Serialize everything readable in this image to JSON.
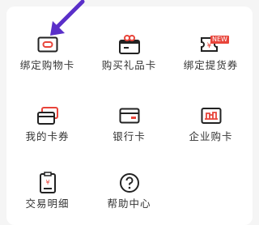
{
  "items": [
    {
      "label": "绑定购物卡",
      "icon": "bind-card-icon"
    },
    {
      "label": "购买礼品卡",
      "icon": "gift-card-icon"
    },
    {
      "label": "绑定提货券",
      "icon": "pickup-voucher-icon",
      "badge": "NEW"
    },
    {
      "label": "我的卡券",
      "icon": "my-cards-icon"
    },
    {
      "label": "银行卡",
      "icon": "bank-card-icon"
    },
    {
      "label": "企业购卡",
      "icon": "enterprise-card-icon"
    },
    {
      "label": "交易明细",
      "icon": "transaction-detail-icon"
    },
    {
      "label": "帮助中心",
      "icon": "help-icon"
    }
  ],
  "colors": {
    "accent": "#e8443a",
    "arrow": "#5a2fc9",
    "icon": "#222222"
  }
}
